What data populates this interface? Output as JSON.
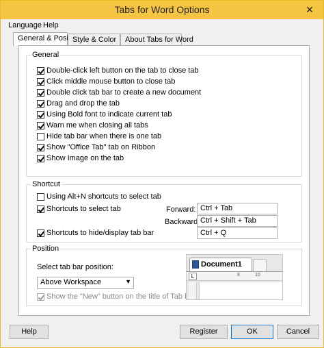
{
  "window": {
    "title": "Tabs for Word Options",
    "close_glyph": "✕"
  },
  "menu": {
    "language": "Language",
    "help": "Help"
  },
  "tabs": [
    {
      "label": "General & Position"
    },
    {
      "label": "Style & Color"
    },
    {
      "label": "About Tabs for Word"
    }
  ],
  "general": {
    "title": "General",
    "options": [
      {
        "label": "Double-click left button on the tab to close tab",
        "checked": true
      },
      {
        "label": "Click middle mouse button to close tab",
        "checked": true
      },
      {
        "label": "Double click tab bar to create a new document",
        "checked": true
      },
      {
        "label": "Drag and drop the tab",
        "checked": true
      },
      {
        "label": "Using Bold font to indicate current tab",
        "checked": true
      },
      {
        "label": "Warn me when closing all tabs",
        "checked": true
      },
      {
        "label": "Hide tab bar when there is one tab",
        "checked": false
      },
      {
        "label": "Show \"Office Tab\" tab on Ribbon",
        "checked": true
      },
      {
        "label": "Show Image on the tab",
        "checked": true
      }
    ]
  },
  "shortcut": {
    "title": "Shortcut",
    "alt_n": {
      "label": "Using Alt+N shortcuts to select tab",
      "checked": false
    },
    "select_tab": {
      "label": "Shortcuts to select tab",
      "checked": true
    },
    "forward_label": "Forward:",
    "forward_value": "Ctrl + Tab",
    "backward_label": "Backward:",
    "backward_value": "Ctrl + Shift + Tab",
    "hide_display": {
      "label": "Shortcuts to hide/display tab bar",
      "checked": true
    },
    "hide_display_value": "Ctrl + Q"
  },
  "position": {
    "title": "Position",
    "select_label": "Select tab bar position:",
    "selected": "Above Workspace",
    "show_new": {
      "label": "Show the \"New\" button on the title of Tab bar",
      "checked": true
    },
    "preview": {
      "doc_tab_label": "Document1",
      "ruler_corner": "L",
      "ruler_numbers": [
        "8",
        "10"
      ]
    }
  },
  "buttons": {
    "help": "Help",
    "register": "Register",
    "ok": "OK",
    "cancel": "Cancel"
  }
}
